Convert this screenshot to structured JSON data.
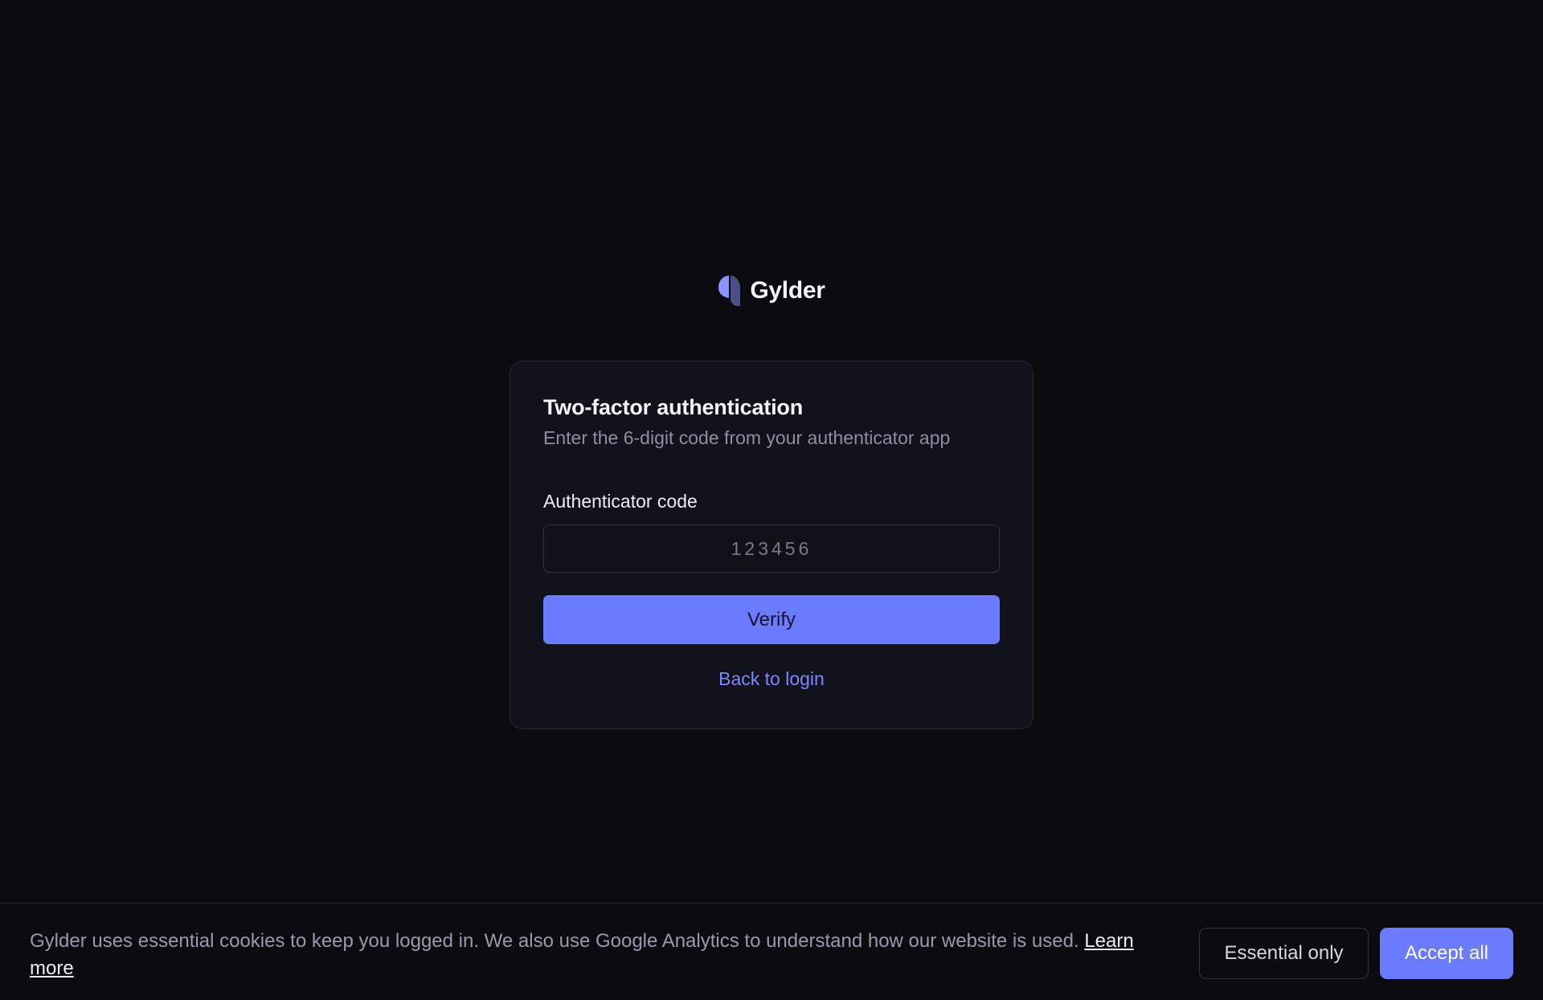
{
  "brand": {
    "name": "Gylder",
    "logo_icon": "gylder-logo-icon",
    "logo_colors": [
      "#8a94ff",
      "#4b4f86"
    ]
  },
  "card": {
    "title": "Two-factor authentication",
    "subtitle": "Enter the 6-digit code from your authenticator app",
    "code_field": {
      "label": "Authenticator code",
      "value": "",
      "placeholder": "123456"
    },
    "verify_label": "Verify",
    "back_link_label": "Back to login"
  },
  "cookie_banner": {
    "text": "Gylder uses essential cookies to keep you logged in. We also use Google Analytics to understand how our website is used.",
    "learn_more_label": "Learn more",
    "essential_only_label": "Essential only",
    "accept_all_label": "Accept all"
  },
  "colors": {
    "background": "#0b0b10",
    "card_background": "#12121c",
    "accent": "#6b7bff",
    "link": "#7c88ff"
  }
}
